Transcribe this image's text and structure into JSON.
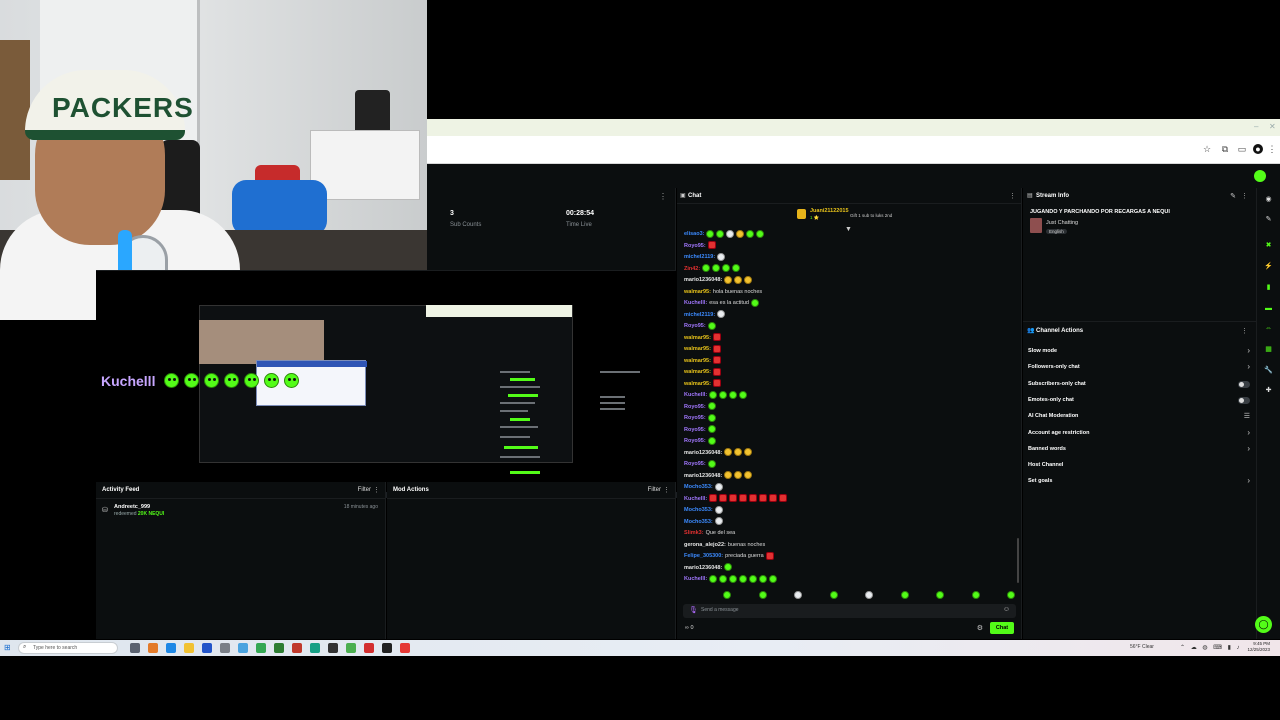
{
  "stats": {
    "sub_count": "3",
    "sub_label": "Sub Counts",
    "time_value": "00:28:54",
    "time_label": "Time Live"
  },
  "overlay": {
    "streamer_name": "Kuchelll"
  },
  "activity_feed": {
    "title": "Activity Feed",
    "filter_label": "Filter",
    "items": [
      {
        "user": "Andreetc_999",
        "desc": "redeemed",
        "amount": "20K NEQUI",
        "time": "18 minutes ago"
      }
    ]
  },
  "mod_actions": {
    "title": "Mod Actions",
    "filter_label": "Filter"
  },
  "chat": {
    "title": "Chat",
    "pinned": {
      "user": "Juani21122015",
      "text": "Gift 1 sub to luks 2nd",
      "sub": "1 ⭐"
    },
    "messages": [
      {
        "user": "elisao3:",
        "color": "#3c8bff",
        "text": "",
        "emotes": [
          "g",
          "g",
          "w",
          "y",
          "g",
          "g"
        ]
      },
      {
        "user": "Royo95:",
        "color": "#a278ff",
        "text": "",
        "emotes": [
          "r"
        ]
      },
      {
        "user": "michel2119:",
        "color": "#3c8bff",
        "text": "",
        "emotes": [
          "w"
        ]
      },
      {
        "user": "Zin42:",
        "color": "#e23131",
        "text": "",
        "emotes": [
          "g",
          "g",
          "g",
          "g"
        ]
      },
      {
        "user": "mario1236048:",
        "color": "#e6e6e6",
        "text": "",
        "emotes": [
          "y",
          "y",
          "y"
        ]
      },
      {
        "user": "walmar95:",
        "color": "#e7c21a",
        "text": "hola buenas noches",
        "emotes": []
      },
      {
        "user": "Kuchelll:",
        "color": "#a278ff",
        "text": "esa es la actitud",
        "emotes": [
          "g"
        ]
      },
      {
        "user": "michel2119:",
        "color": "#3c8bff",
        "text": "",
        "emotes": [
          "w"
        ]
      },
      {
        "user": "Royo95:",
        "color": "#a278ff",
        "text": "",
        "emotes": [
          "g"
        ]
      },
      {
        "user": "walmar95:",
        "color": "#e7c21a",
        "text": "",
        "emotes": [
          "r"
        ]
      },
      {
        "user": "walmar95:",
        "color": "#e7c21a",
        "text": "",
        "emotes": [
          "r"
        ]
      },
      {
        "user": "walmar95:",
        "color": "#e7c21a",
        "text": "",
        "emotes": [
          "r"
        ]
      },
      {
        "user": "walmar95:",
        "color": "#e7c21a",
        "text": "",
        "emotes": [
          "r"
        ]
      },
      {
        "user": "walmar95:",
        "color": "#e7c21a",
        "text": "",
        "emotes": [
          "r"
        ]
      },
      {
        "user": "Kuchelll:",
        "color": "#a278ff",
        "text": "",
        "emotes": [
          "g",
          "g",
          "g",
          "g"
        ]
      },
      {
        "user": "Royo95:",
        "color": "#a278ff",
        "text": "",
        "emotes": [
          "g"
        ]
      },
      {
        "user": "Royo95:",
        "color": "#a278ff",
        "text": "",
        "emotes": [
          "g"
        ]
      },
      {
        "user": "Royo95:",
        "color": "#a278ff",
        "text": "",
        "emotes": [
          "g"
        ]
      },
      {
        "user": "Royo95:",
        "color": "#a278ff",
        "text": "",
        "emotes": [
          "g"
        ]
      },
      {
        "user": "mario1236048:",
        "color": "#e6e6e6",
        "text": "",
        "emotes": [
          "y",
          "y",
          "y"
        ]
      },
      {
        "user": "Royo95:",
        "color": "#a278ff",
        "text": "",
        "emotes": [
          "g"
        ]
      },
      {
        "user": "mario1236048:",
        "color": "#e6e6e6",
        "text": "",
        "emotes": [
          "y",
          "y",
          "y"
        ]
      },
      {
        "user": "Mocho353:",
        "color": "#3c8bff",
        "text": "",
        "emotes": [
          "w"
        ]
      },
      {
        "user": "Kuchelll:",
        "color": "#a278ff",
        "text": "",
        "emotes": [
          "r",
          "r",
          "r",
          "r",
          "r",
          "r",
          "r",
          "r"
        ]
      },
      {
        "user": "Mocho353:",
        "color": "#3c8bff",
        "text": "",
        "emotes": [
          "w"
        ]
      },
      {
        "user": "Mocho353:",
        "color": "#3c8bff",
        "text": "",
        "emotes": [
          "w"
        ]
      },
      {
        "user": "Slimk3:",
        "color": "#e23131",
        "text": "Que del sea",
        "emotes": []
      },
      {
        "user": "gerona_alejo22:",
        "color": "#e6e6e6",
        "text": "buenas noches",
        "emotes": []
      },
      {
        "user": "Felipe_305300:",
        "color": "#3c8bff",
        "text": "preciada guerra",
        "emotes": [
          "r"
        ]
      },
      {
        "user": "mario1236048:",
        "color": "#e6e6e6",
        "text": "",
        "emotes": [
          "g"
        ]
      },
      {
        "user": "Kuchelll:",
        "color": "#a278ff",
        "text": "",
        "emotes": [
          "g",
          "g",
          "g",
          "g",
          "g",
          "g",
          "g"
        ]
      }
    ],
    "input_placeholder": "Send a message",
    "footer_left": "∞  0",
    "send_label": "Chat"
  },
  "stream_info": {
    "title": "Stream Info",
    "stream_title": "JUGANDO Y PARCHANDO POR RECARGAS A NEQUI",
    "category": "Just Chatting",
    "language": "English"
  },
  "channel_actions": {
    "title": "Channel Actions",
    "items": [
      {
        "label": "Slow mode",
        "control": "chevron"
      },
      {
        "label": "Followers-only chat",
        "control": "chevron"
      },
      {
        "label": "Subscribers-only chat",
        "control": "toggle"
      },
      {
        "label": "Emotes-only chat",
        "control": "toggle"
      },
      {
        "label": "AI Chat Moderation",
        "control": "sliders"
      },
      {
        "label": "Account age restriction",
        "control": "chevron"
      },
      {
        "label": "Banned words",
        "control": "chevron"
      },
      {
        "label": "Host Channel",
        "control": "none"
      },
      {
        "label": "Set goals",
        "control": "chevron"
      }
    ]
  },
  "taskbar": {
    "search_placeholder": "Type here to search",
    "weather": "56°F Clear",
    "time": "9:45 PM",
    "date": "12/25/2023"
  },
  "colors": {
    "kick_green": "#53fc18",
    "panel_bg": "#0b0e0f",
    "accent_purple": "#a278ff"
  }
}
